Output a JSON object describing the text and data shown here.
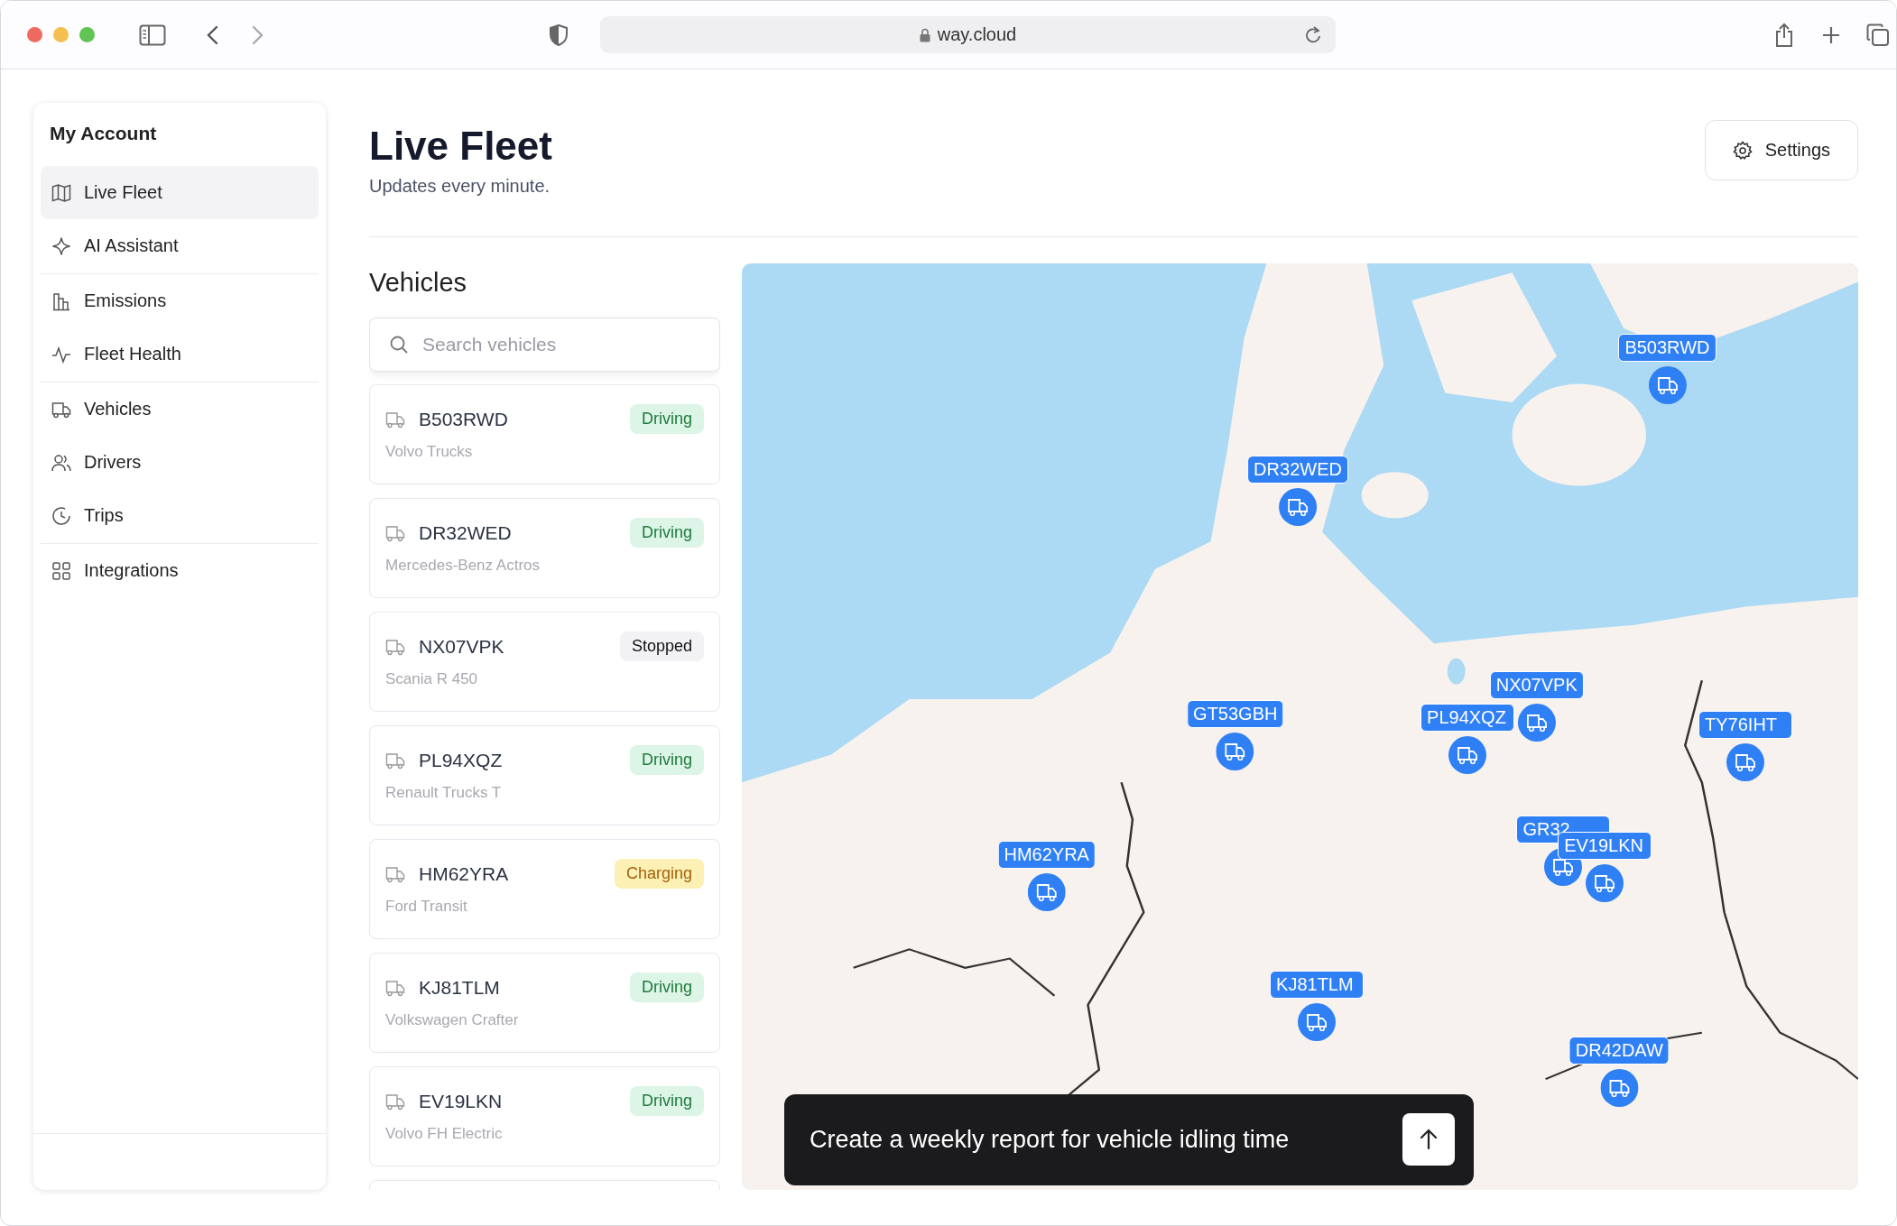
{
  "browser": {
    "url": "way.cloud"
  },
  "sidebar": {
    "title": "My Account",
    "groups": [
      {
        "items": [
          {
            "label": "Live Fleet",
            "selected": true
          },
          {
            "label": "AI Assistant",
            "selected": false
          }
        ]
      },
      {
        "items": [
          {
            "label": "Emissions",
            "selected": false
          },
          {
            "label": "Fleet Health",
            "selected": false
          }
        ]
      },
      {
        "items": [
          {
            "label": "Vehicles",
            "selected": false
          },
          {
            "label": "Drivers",
            "selected": false
          },
          {
            "label": "Trips",
            "selected": false
          }
        ]
      },
      {
        "items": [
          {
            "label": "Integrations",
            "selected": false
          }
        ]
      }
    ]
  },
  "header": {
    "title": "Live Fleet",
    "subtitle": "Updates every minute.",
    "settings_button": "Settings"
  },
  "vehicles": {
    "heading": "Vehicles",
    "search": {
      "placeholder": "Search vehicles"
    },
    "items": [
      {
        "plate": "B503RWD",
        "model": "Volvo Trucks",
        "status": {
          "label": "Driving",
          "kind": "driving"
        }
      },
      {
        "plate": "DR32WED",
        "model": "Mercedes-Benz Actros",
        "status": {
          "label": "Driving",
          "kind": "driving"
        }
      },
      {
        "plate": "NX07VPK",
        "model": "Scania R 450",
        "status": {
          "label": "Stopped",
          "kind": "stopped"
        }
      },
      {
        "plate": "PL94XQZ",
        "model": "Renault Trucks T",
        "status": {
          "label": "Driving",
          "kind": "driving"
        }
      },
      {
        "plate": "HM62YRA",
        "model": "Ford Transit",
        "status": {
          "label": "Charging",
          "kind": "charging"
        }
      },
      {
        "plate": "KJ81TLM",
        "model": "Volkswagen Crafter",
        "status": {
          "label": "Driving",
          "kind": "driving"
        }
      },
      {
        "plate": "EV19LKN",
        "model": "Volvo FH Electric",
        "status": {
          "label": "Driving",
          "kind": "driving"
        }
      }
    ]
  },
  "map": {
    "markers": [
      {
        "label": "B503RWD"
      },
      {
        "label": "DR32WED"
      },
      {
        "label": "GT53GBH"
      },
      {
        "label": "NX07VPK"
      },
      {
        "label": "PL94XQZ"
      },
      {
        "label": "TY76IHT"
      },
      {
        "label": "HM62YRA"
      },
      {
        "label": "GR32"
      },
      {
        "label": "EV19LKN"
      },
      {
        "label": "KJ81TLM"
      },
      {
        "label": "DR42DAW"
      }
    ]
  },
  "prompt": {
    "value": "Create a weekly report for vehicle idling time"
  }
}
